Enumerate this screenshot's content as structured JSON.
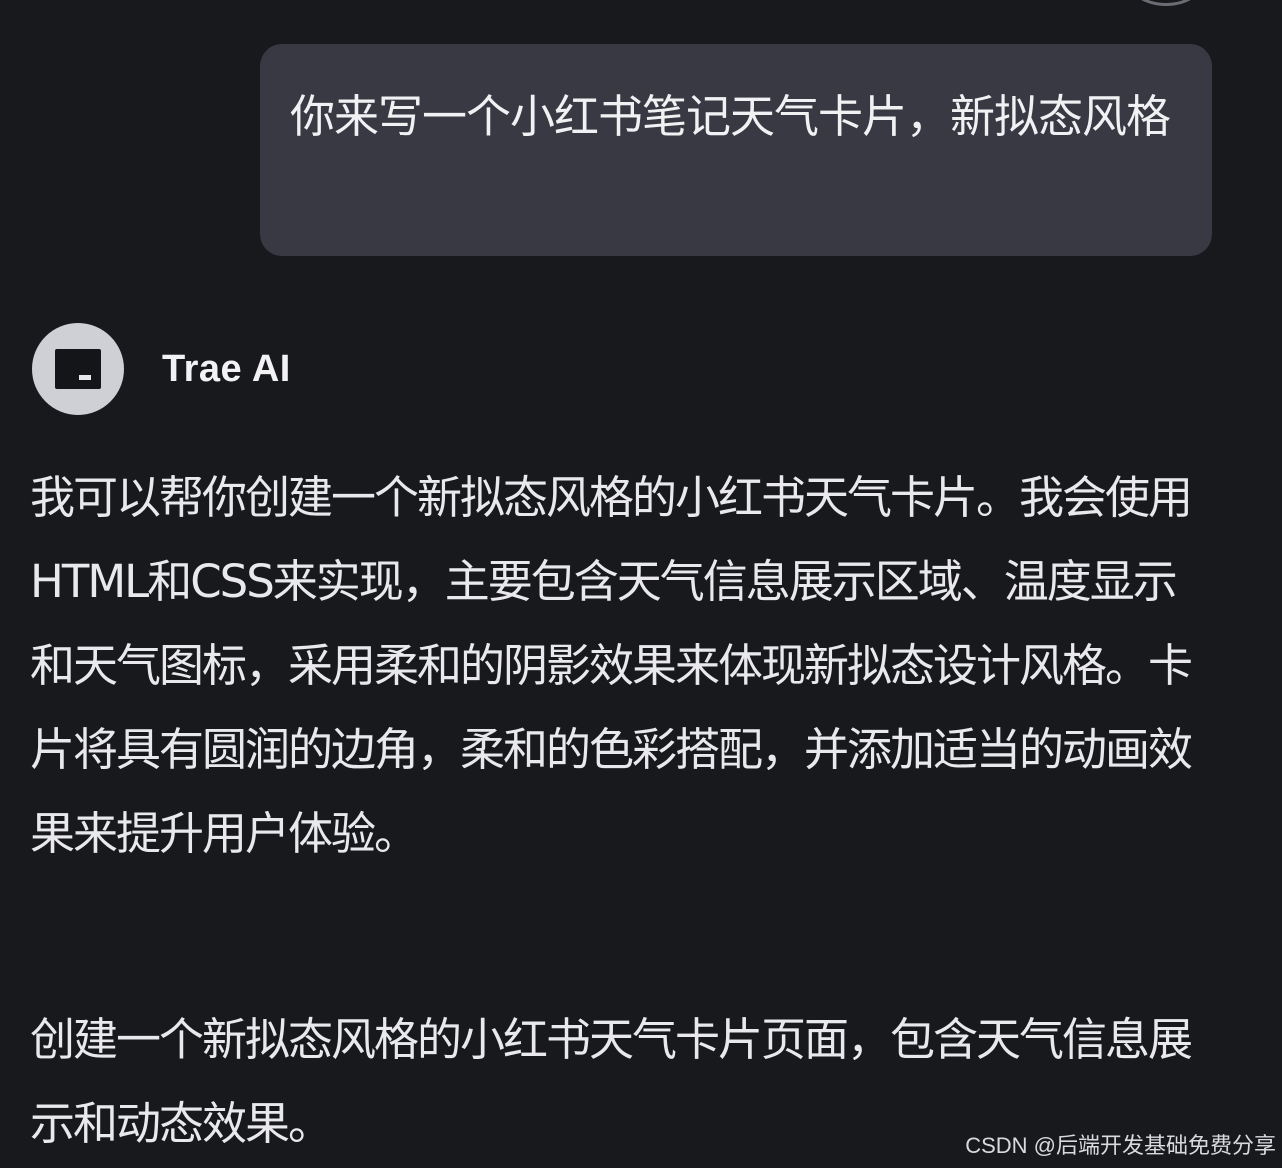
{
  "user_message": {
    "text": "你来写一个小红书笔记天气卡片，新拟态风格"
  },
  "assistant": {
    "name": "Trae AI",
    "paragraphs": [
      "我可以帮你创建一个新拟态风格的小红书天气卡片。我会使用HTML和CSS来实现，主要包含天气信息展示区域、温度显示和天气图标，采用柔和的阴影效果来体现新拟态设计风格。卡片将具有圆润的边角，柔和的色彩搭配，并添加适当的动画效果来提升用户体验。",
      "创建一个新拟态风格的小红书天气卡片页面，包含天气信息展示和动态效果。"
    ]
  },
  "watermark": "CSDN @后端开发基础免费分享",
  "icons": {
    "assistant_avatar": "trae-logo-icon",
    "user_avatar": "user-avatar-icon"
  },
  "colors": {
    "background": "#18191d",
    "user_bubble": "#393944",
    "text": "#e9e9ed"
  }
}
